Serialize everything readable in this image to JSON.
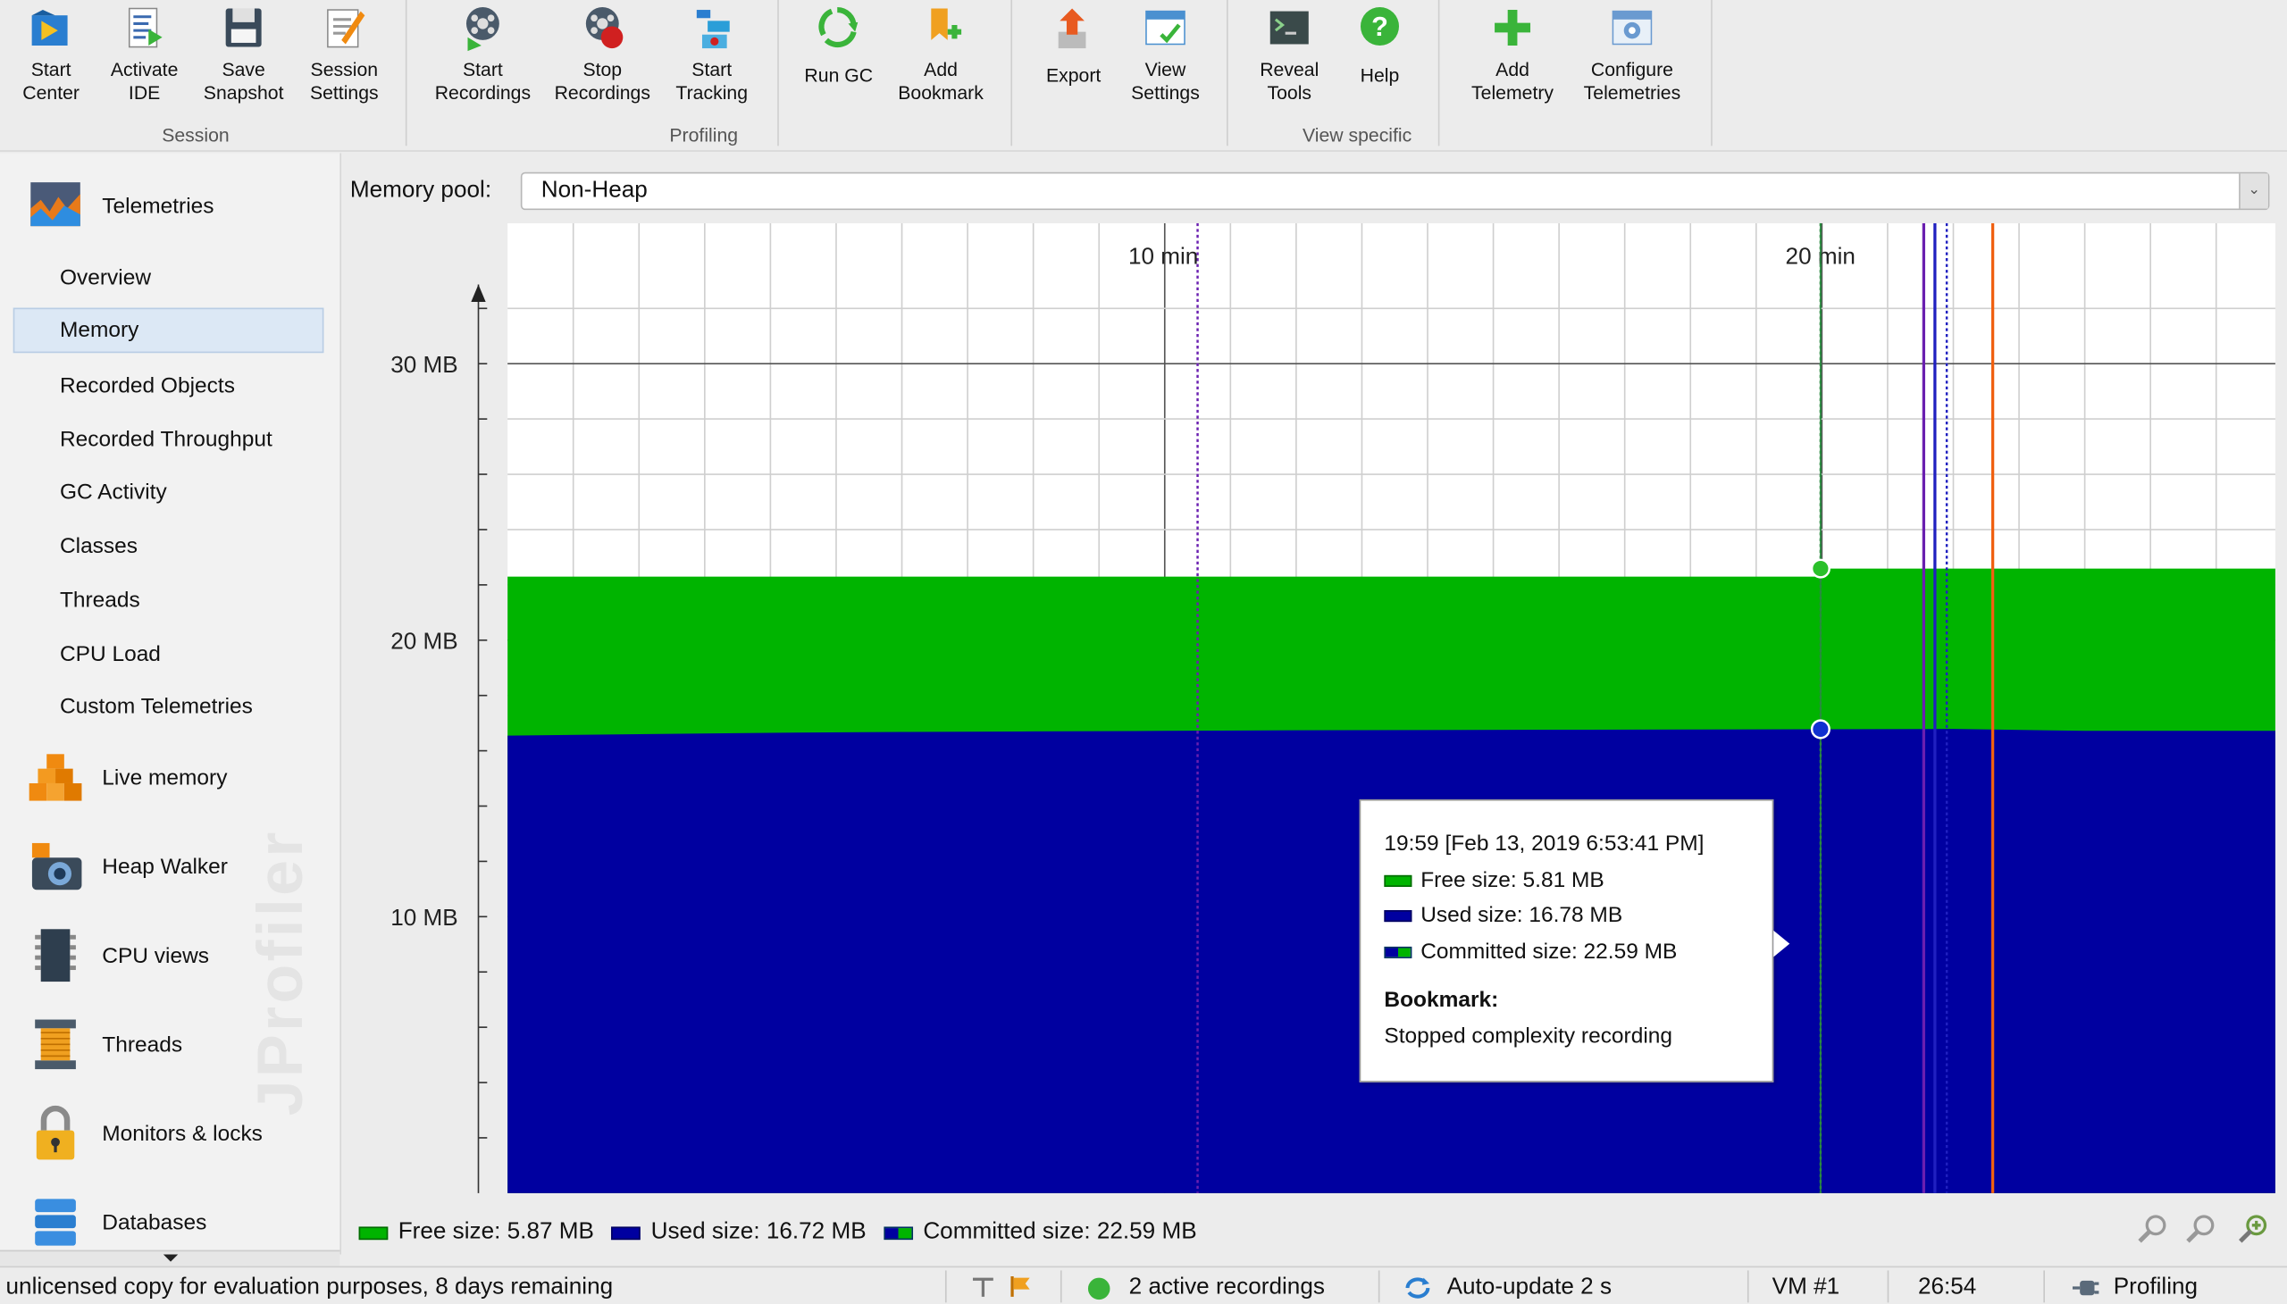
{
  "toolbar": {
    "groups": [
      {
        "label": "Session"
      },
      {
        "label": "Profiling"
      },
      {
        "label": "View specific"
      }
    ],
    "buttons": [
      {
        "label1": "Start",
        "label2": "Center",
        "icon": "start-center-icon"
      },
      {
        "label1": "Activate",
        "label2": "IDE",
        "icon": "activate-ide-icon"
      },
      {
        "label1": "Save",
        "label2": "Snapshot",
        "icon": "save-snapshot-icon"
      },
      {
        "label1": "Session",
        "label2": "Settings",
        "icon": "session-settings-icon"
      },
      {
        "label1": "Start",
        "label2": "Recordings",
        "icon": "start-recordings-icon"
      },
      {
        "label1": "Stop",
        "label2": "Recordings",
        "icon": "stop-recordings-icon"
      },
      {
        "label1": "Start",
        "label2": "Tracking",
        "icon": "start-tracking-icon"
      },
      {
        "label1": "Run GC",
        "label2": "",
        "icon": "run-gc-icon"
      },
      {
        "label1": "Add",
        "label2": "Bookmark",
        "icon": "add-bookmark-icon"
      },
      {
        "label1": "Export",
        "label2": "",
        "icon": "export-icon"
      },
      {
        "label1": "View",
        "label2": "Settings",
        "icon": "view-settings-icon"
      },
      {
        "label1": "Reveal",
        "label2": "Tools",
        "icon": "reveal-tools-icon"
      },
      {
        "label1": "Help",
        "label2": "",
        "icon": "help-icon"
      },
      {
        "label1": "Add",
        "label2": "Telemetry",
        "icon": "add-telemetry-icon"
      },
      {
        "label1": "Configure",
        "label2": "Telemetries",
        "icon": "configure-telemetries-icon"
      }
    ]
  },
  "sidebar": {
    "telemetries": "Telemetries",
    "items": [
      "Overview",
      "Memory",
      "Recorded Objects",
      "Recorded Throughput",
      "GC Activity",
      "Classes",
      "Threads",
      "CPU Load",
      "Custom Telemetries"
    ],
    "active_item": "Memory",
    "sections": [
      "Live memory",
      "Heap Walker",
      "CPU views",
      "Threads",
      "Monitors & locks",
      "Databases"
    ],
    "watermark": "JProfiler"
  },
  "main": {
    "pool_label": "Memory pool:",
    "pool_value": "Non-Heap"
  },
  "colors": {
    "free": "#00b400",
    "used": "#0000a0",
    "bookmark_purple": "#6a1fb0",
    "bookmark_blue": "#2020c0",
    "bookmark_orange": "#f06010"
  },
  "chart_data": {
    "type": "area",
    "x_unit": "min",
    "x_ticks": [
      "10 min",
      "20 min"
    ],
    "x_tick_values": [
      10,
      20
    ],
    "xlim": [
      0,
      26.9
    ],
    "y_ticks": [
      "10 MB",
      "20 MB",
      "30 MB"
    ],
    "y_tick_values": [
      10,
      20,
      30
    ],
    "ylim": [
      0,
      33.5
    ],
    "series": [
      {
        "name": "Used size",
        "x": [
          0,
          2,
          4,
          6,
          8,
          10,
          12,
          14,
          16,
          18,
          19.98,
          22,
          24,
          26.9
        ],
        "values": [
          16.55,
          16.6,
          16.65,
          16.68,
          16.7,
          16.72,
          16.74,
          16.75,
          16.76,
          16.77,
          16.78,
          16.79,
          16.72,
          16.72
        ]
      },
      {
        "name": "Committed size",
        "x": [
          0,
          19.98,
          19.99,
          26.9
        ],
        "values": [
          22.3,
          22.3,
          22.59,
          22.59
        ]
      }
    ],
    "bookmarks": [
      {
        "x": 10.5,
        "style": "dotted",
        "color": "#6a1fb0"
      },
      {
        "x": 19.98,
        "style": "dotted",
        "color": "#2a8a40"
      },
      {
        "x": 21.55,
        "style": "solid",
        "color": "#6a1fb0"
      },
      {
        "x": 21.72,
        "style": "solid",
        "color": "#2020c0"
      },
      {
        "x": 21.9,
        "style": "dotted",
        "color": "#2020c0"
      },
      {
        "x": 22.6,
        "style": "solid",
        "color": "#f06010"
      }
    ],
    "grid": true,
    "legend": "bottom"
  },
  "tooltip": {
    "time": "19:59 [Feb 13, 2019 6:53:41 PM]",
    "free": "Free size:  5.81 MB",
    "used": "Used size:  16.78 MB",
    "committed": "Committed size:  22.59 MB",
    "bookmark_title": "Bookmark:",
    "bookmark_text": "Stopped complexity recording"
  },
  "legend": {
    "free": "Free size: 5.87 MB",
    "used": "Used size: 16.72 MB",
    "committed": "Committed size: 22.59 MB"
  },
  "status": {
    "license": "unlicensed copy for evaluation purposes, 8 days remaining",
    "recordings": "2 active recordings",
    "autoupdate": "Auto-update 2 s",
    "vm": "VM #1",
    "time": "26:54",
    "mode": "Profiling"
  }
}
